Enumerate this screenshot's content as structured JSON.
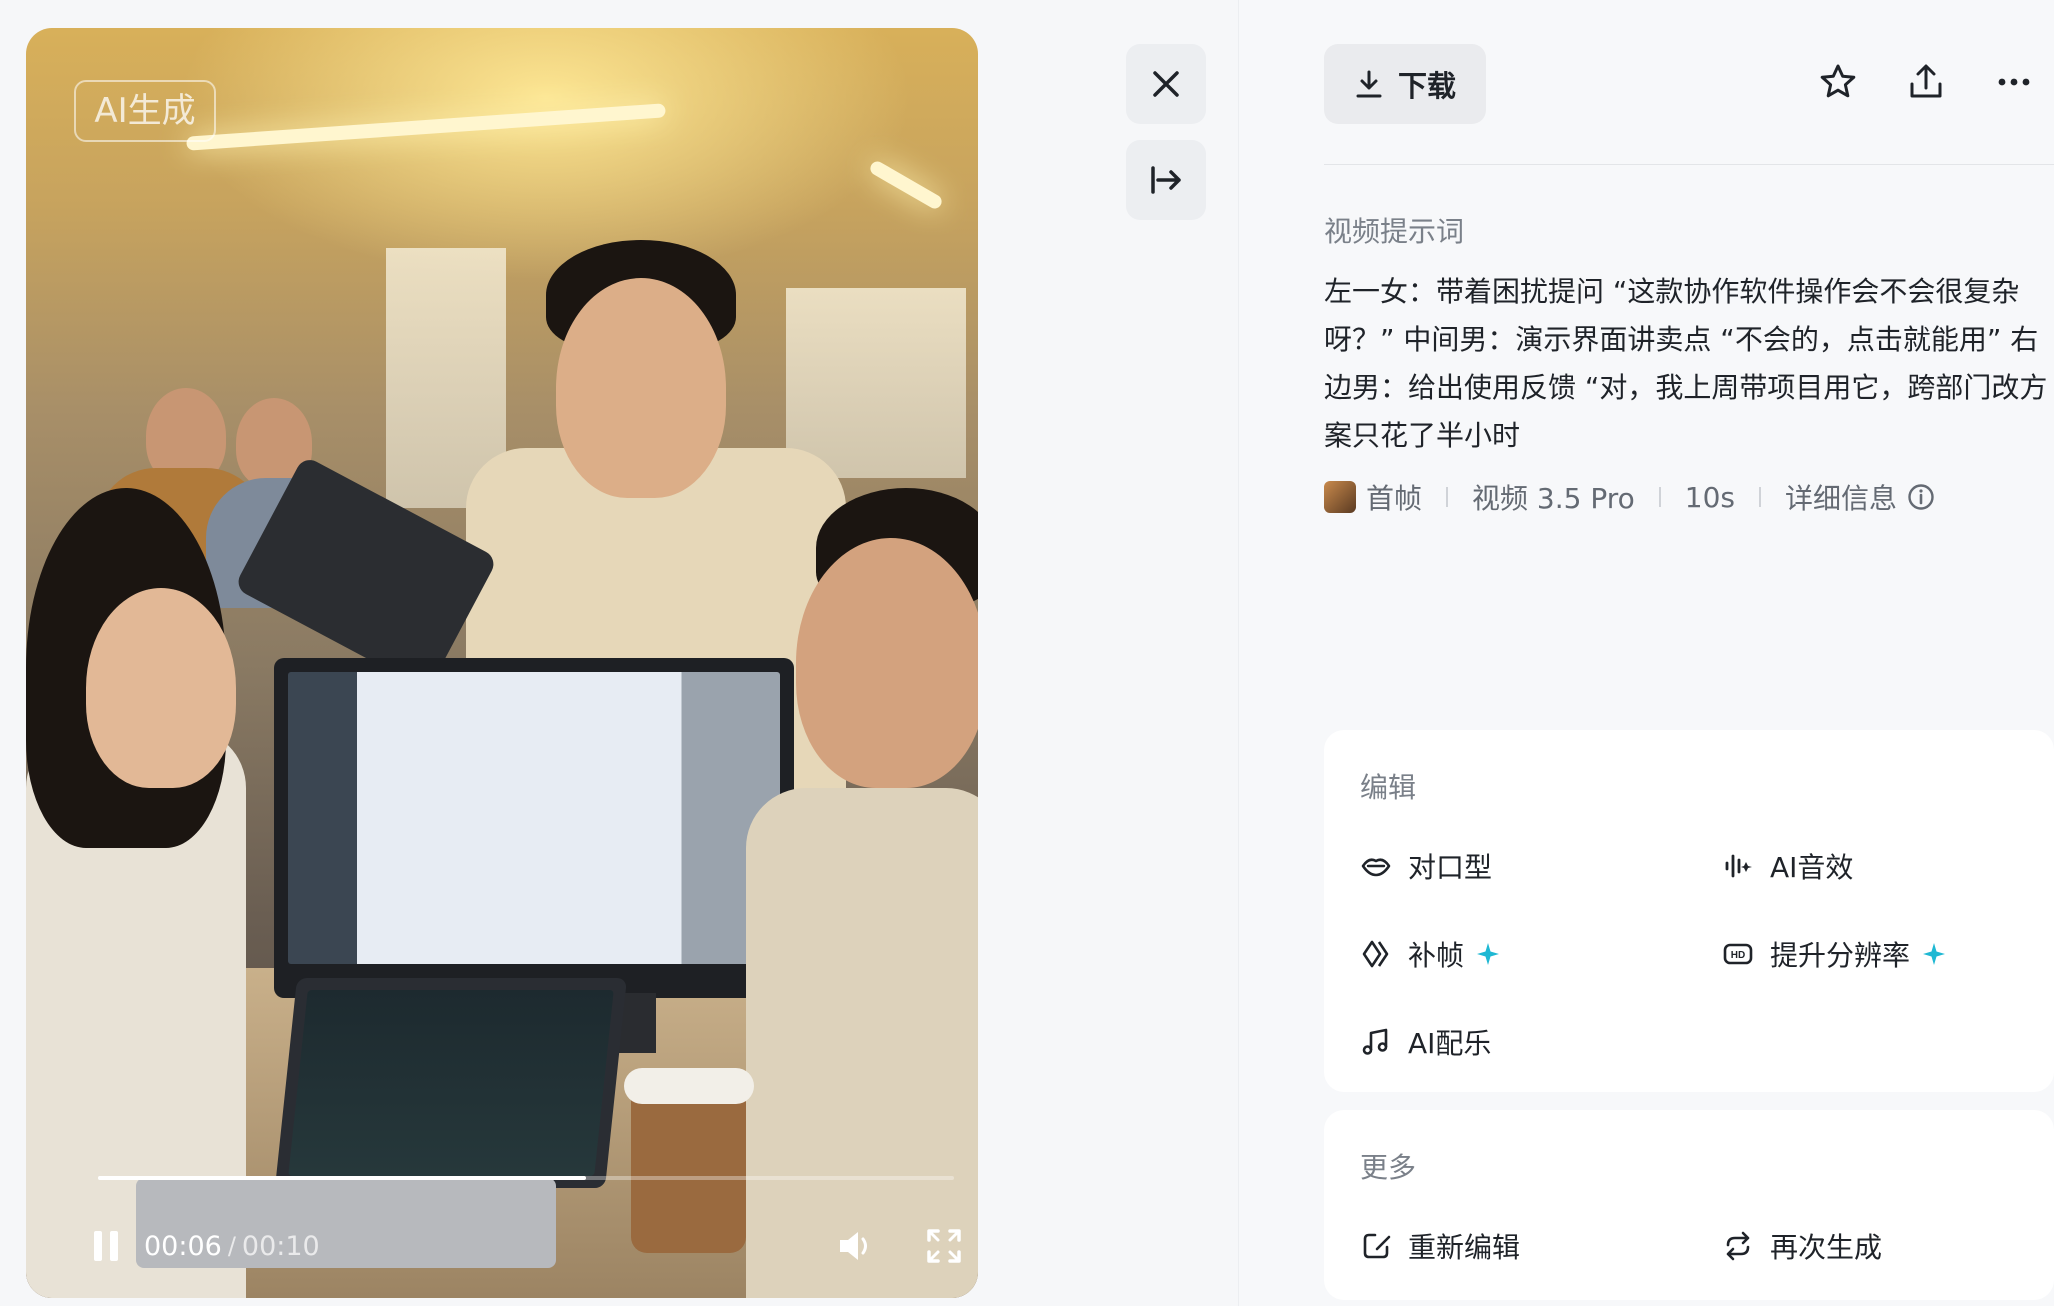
{
  "video": {
    "badge": "AI生成",
    "current_time": "00:06",
    "separator": "/",
    "total_time": "00:10",
    "progress": 0.57
  },
  "toolbar": {
    "download_label": "下载"
  },
  "prompt": {
    "title": "视频提示词",
    "text": "左一女：带着困扰提问 “这款协作软件操作会不会很复杂呀？” 中间男：演示界面讲卖点 “不会的，点击就能用” 右边男：给出使用反馈 “对，我上周带项目用它，跨部门改方案只花了半小时"
  },
  "meta": {
    "first_frame": "首帧",
    "model": "视频 3.5 Pro",
    "duration": "10s",
    "details": "详细信息"
  },
  "edit": {
    "title": "编辑",
    "lip_sync": "对口型",
    "ai_sfx": "AI音效",
    "interpolate": "补帧",
    "upscale": "提升分辨率",
    "ai_music": "AI配乐"
  },
  "more": {
    "title": "更多",
    "re_edit": "重新编辑",
    "regenerate": "再次生成"
  },
  "colors": {
    "accent_spark": "#1fb8d3",
    "button_bg": "#eaebee",
    "panel_bg": "#f7f8fa"
  }
}
